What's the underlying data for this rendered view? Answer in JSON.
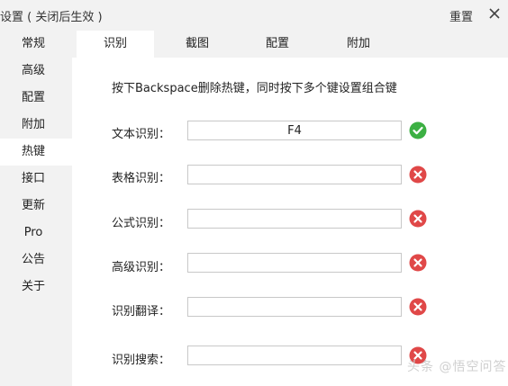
{
  "window": {
    "title": "设置 ( 关闭后生效 )",
    "reset_label": "重置",
    "close_icon": "close-icon"
  },
  "sidebar": {
    "items": [
      {
        "label": "常规"
      },
      {
        "label": "高级"
      },
      {
        "label": "配置"
      },
      {
        "label": "附加"
      },
      {
        "label": "热键",
        "active": true
      },
      {
        "label": "接口"
      },
      {
        "label": "更新"
      },
      {
        "label": "Pro"
      },
      {
        "label": "公告"
      },
      {
        "label": "关于"
      }
    ]
  },
  "tabs": [
    {
      "label": "识别",
      "active": true
    },
    {
      "label": "截图"
    },
    {
      "label": "配置"
    },
    {
      "label": "附加"
    }
  ],
  "hotkeys": {
    "instruction": "按下Backspace删除热键，同时按下多个键设置组合键",
    "rows": [
      {
        "label": "文本识别：",
        "value": "F4",
        "status": "ok"
      },
      {
        "label": "表格识别：",
        "value": "",
        "status": "error"
      },
      {
        "label": "公式识别：",
        "value": "",
        "status": "error"
      },
      {
        "label": "高级识别：",
        "value": "",
        "status": "error"
      },
      {
        "label": "识别翻译：",
        "value": "",
        "status": "error"
      },
      {
        "label": "识别搜索：",
        "value": "",
        "status": "error"
      }
    ]
  },
  "colors": {
    "ok": "#3cb043",
    "error": "#e04848"
  },
  "watermark": {
    "text": "头条 @悟空问答"
  }
}
